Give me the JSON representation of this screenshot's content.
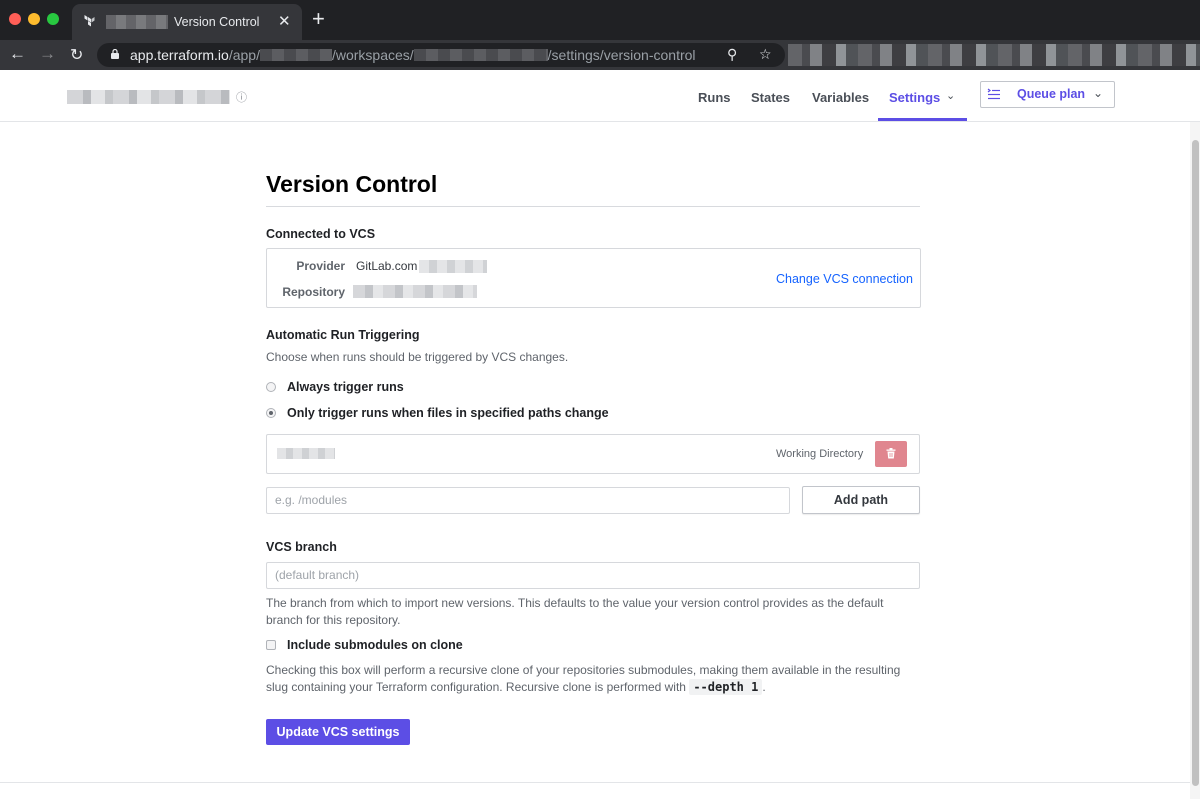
{
  "browser": {
    "tab_title": "Version Control",
    "tab_close": "✕",
    "new_tab": "+",
    "url_prefix": "app.terraform.io",
    "url_segment_app": "/app/",
    "url_segment_workspaces": "/workspaces/",
    "url_segment_settings": "/settings/version-control"
  },
  "header": {
    "nav": [
      "Runs",
      "States",
      "Variables",
      "Settings"
    ],
    "active_nav": "Settings",
    "queue_plan_label": "Queue plan",
    "accent_color": "#5c4ee5"
  },
  "page": {
    "title": "Version Control",
    "connected_label": "Connected to VCS",
    "provider_key": "Provider",
    "provider_value": "GitLab.com",
    "repository_key": "Repository",
    "change_link": "Change VCS connection",
    "trigger_label": "Automatic Run Triggering",
    "trigger_help": "Choose when runs should be triggered by VCS changes.",
    "option_always": "Always trigger runs",
    "option_paths": "Only trigger runs when files in specified paths change",
    "selected_option": "option_paths",
    "path_tag": "Working Directory",
    "path_placeholder": "e.g. /modules",
    "add_path_label": "Add path",
    "branch_label": "VCS branch",
    "branch_placeholder": "(default branch)",
    "branch_help_line1": "The branch from which to import new versions. This defaults to the value your version control provides as the default",
    "branch_help_line2": "branch for this repository.",
    "submodules_label": "Include submodules on clone",
    "submodules_checked": false,
    "submodules_help_line1": "Checking this box will perform a recursive clone of your repositories submodules, making them available in the resulting",
    "submodules_help_line2": "slug containing your Terraform configuration. Recursive clone is performed with",
    "submodules_code": "--depth 1",
    "submodules_help_end": ".",
    "submit_label": "Update VCS settings",
    "danger_color": "#e0868f",
    "link_color": "#1563ff"
  }
}
